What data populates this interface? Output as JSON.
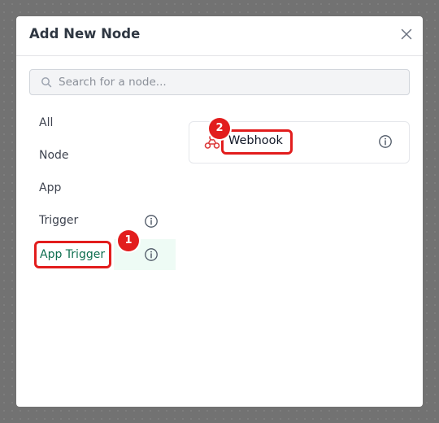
{
  "modal": {
    "title": "Add New Node",
    "close_icon": "close-icon"
  },
  "search": {
    "placeholder": "Search for a node...",
    "value": "",
    "icon": "search-icon"
  },
  "categories": [
    {
      "label": "All",
      "has_info": false,
      "selected": false
    },
    {
      "label": "Node",
      "has_info": false,
      "selected": false
    },
    {
      "label": "App",
      "has_info": false,
      "selected": false
    },
    {
      "label": "Trigger",
      "has_info": true,
      "selected": false
    },
    {
      "label": "App Trigger",
      "has_info": true,
      "selected": true
    }
  ],
  "nodes": [
    {
      "label": "Webhook",
      "icon": "webhook-icon",
      "info_icon": "info-icon"
    }
  ],
  "annotations": [
    {
      "step": "1",
      "target": "App Trigger"
    },
    {
      "step": "2",
      "target": "Webhook"
    }
  ],
  "colors": {
    "accent_green": "#0e6e4f",
    "selected_bg": "#eefbf5",
    "annotation_red": "#e21d1d",
    "webhook_icon": "#dc3b3b"
  }
}
